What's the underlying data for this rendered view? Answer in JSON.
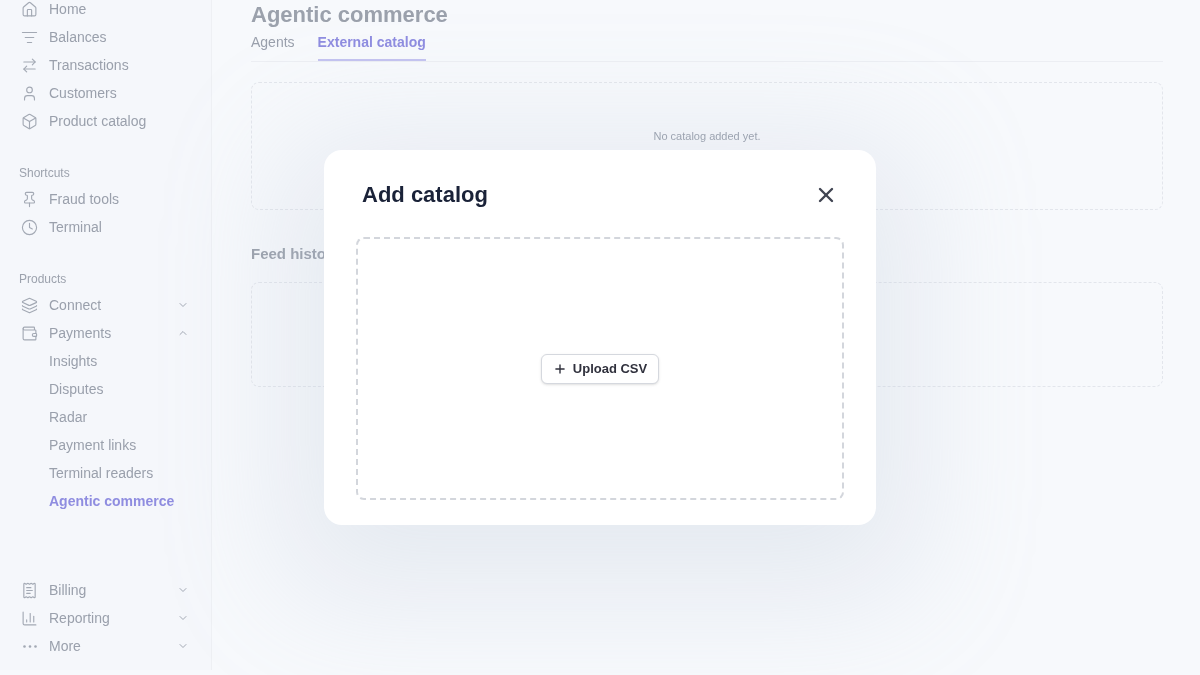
{
  "sidebar": {
    "groups": [
      {
        "items": [
          {
            "label": "Home",
            "selected": false
          },
          {
            "label": "Balances",
            "selected": false
          },
          {
            "label": "Transactions",
            "selected": false
          },
          {
            "label": "Customers",
            "selected": false
          },
          {
            "label": "Product catalog",
            "selected": false
          }
        ]
      },
      {
        "heading": "Shortcuts",
        "items": [
          {
            "label": "Fraud tools",
            "selected": false
          },
          {
            "label": "Terminal",
            "selected": false
          }
        ]
      },
      {
        "heading": "Products",
        "items": [
          {
            "label": "Connect",
            "selected": false,
            "expanded": false
          },
          {
            "label": "Payments",
            "selected": false,
            "expanded": true,
            "children": [
              {
                "label": "Insights",
                "selected": false
              },
              {
                "label": "Disputes",
                "selected": false
              },
              {
                "label": "Radar",
                "selected": false
              },
              {
                "label": "Payment links",
                "selected": false
              },
              {
                "label": "Terminal readers",
                "selected": false
              },
              {
                "label": "Agentic commerce",
                "selected": true
              }
            ]
          }
        ]
      },
      {
        "items": [
          {
            "label": "Billing",
            "selected": false,
            "expanded": false
          },
          {
            "label": "Reporting",
            "selected": false,
            "expanded": false
          },
          {
            "label": "More",
            "selected": false,
            "expanded": false
          }
        ]
      }
    ]
  },
  "page": {
    "title": "Agentic commerce",
    "tabs": [
      {
        "label": "Agents",
        "selected": false
      },
      {
        "label": "External catalog",
        "selected": true
      }
    ],
    "catalog_empty": "No catalog added yet.",
    "feed_heading": "Feed histo"
  },
  "dialog": {
    "title": "Add catalog",
    "upload_button": "Upload CSV"
  }
}
